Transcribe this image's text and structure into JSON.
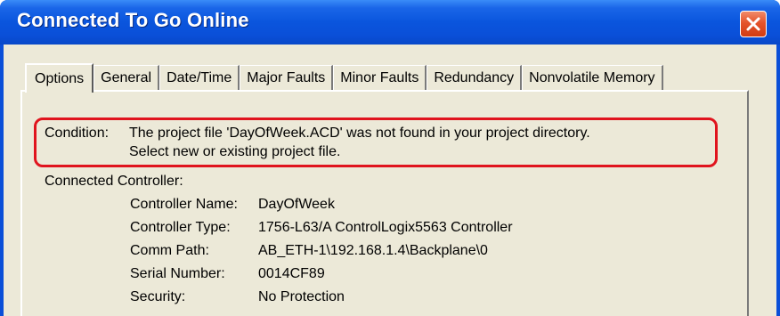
{
  "window": {
    "title": "Connected To Go Online"
  },
  "tabs": [
    {
      "label": "Options",
      "active": true
    },
    {
      "label": "General",
      "active": false
    },
    {
      "label": "Date/Time",
      "active": false
    },
    {
      "label": "Major Faults",
      "active": false
    },
    {
      "label": "Minor Faults",
      "active": false
    },
    {
      "label": "Redundancy",
      "active": false
    },
    {
      "label": "Nonvolatile Memory",
      "active": false
    }
  ],
  "condition": {
    "label": "Condition:",
    "line1": "The project file 'DayOfWeek.ACD' was not found in your project directory.",
    "line2": "Select new or existing project file.",
    "highlight_color": "#e0141e"
  },
  "connected_controller": {
    "heading": "Connected Controller:",
    "fields": [
      {
        "label": "Controller Name:",
        "value": "DayOfWeek"
      },
      {
        "label": "Controller Type:",
        "value": "1756-L63/A ControlLogix5563 Controller"
      },
      {
        "label": "Comm Path:",
        "value": "AB_ETH-1\\192.168.1.4\\Backplane\\0"
      },
      {
        "label": "Serial Number:",
        "value": "0014CF89"
      },
      {
        "label": "Security:",
        "value": "No Protection"
      }
    ]
  },
  "icons": {
    "close": "close-icon"
  },
  "colors": {
    "titlebar": "#0a4fd8",
    "client_bg": "#ece9d8",
    "close_button": "#e4542c"
  }
}
